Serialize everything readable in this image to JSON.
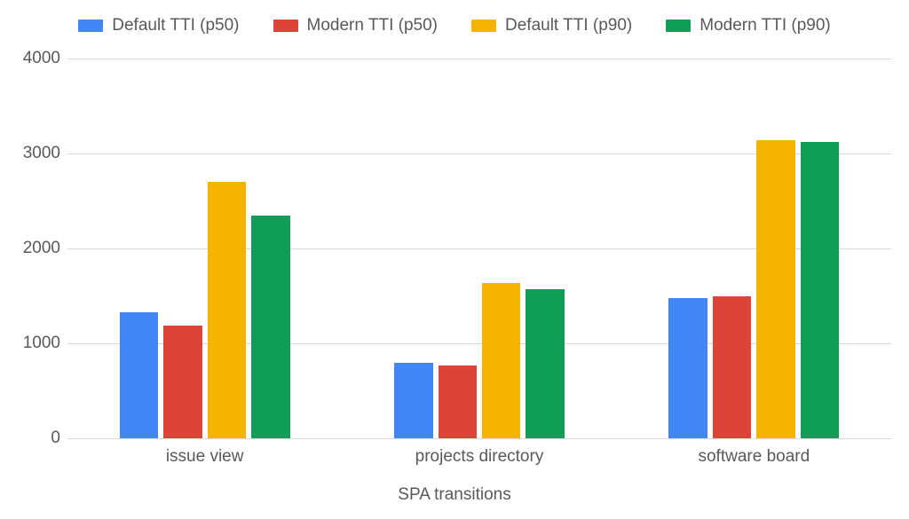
{
  "legend": {
    "items": [
      {
        "label": "Default TTI (p50)",
        "color": "#4285f4"
      },
      {
        "label": "Modern TTI (p50)",
        "color": "#db4437"
      },
      {
        "label": "Default TTI (p90)",
        "color": "#f4b400"
      },
      {
        "label": "Modern TTI (p90)",
        "color": "#0f9d58"
      }
    ]
  },
  "yticks": [
    "0",
    "1000",
    "2000",
    "3000",
    "4000"
  ],
  "xlabel": "SPA transitions",
  "chart_data": {
    "type": "bar",
    "categories": [
      "issue view",
      "projects directory",
      "software board"
    ],
    "series": [
      {
        "name": "Default TTI (p50)",
        "values": [
          1330,
          790,
          1480
        ]
      },
      {
        "name": "Modern TTI (p50)",
        "values": [
          1190,
          770,
          1500
        ]
      },
      {
        "name": "Default TTI (p90)",
        "values": [
          2700,
          1640,
          3140
        ]
      },
      {
        "name": "Modern TTI (p90)",
        "values": [
          2350,
          1570,
          3120
        ]
      }
    ],
    "xlabel": "SPA transitions",
    "ylabel": "",
    "ylim": [
      0,
      4000
    ]
  }
}
